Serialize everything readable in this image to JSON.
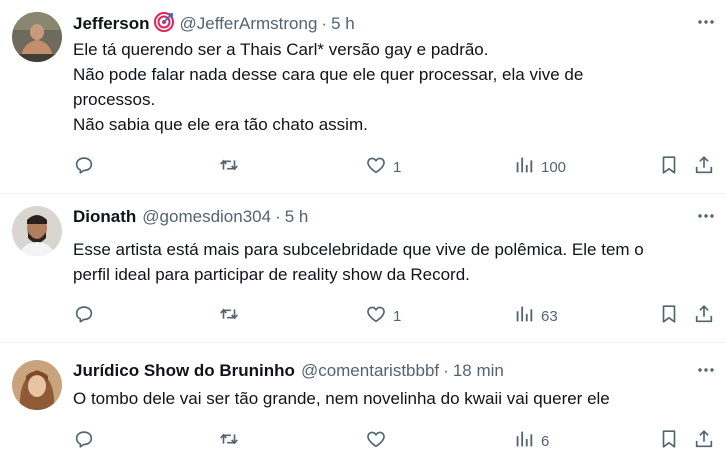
{
  "tweets": [
    {
      "name": "Jefferson",
      "handle": "@JefferArmstrong",
      "time": "5 h",
      "badge_icon": "target-icon",
      "lines": [
        "Ele tá querendo ser a Thais Carl* versão gay e padrão.",
        "Não pode falar nada desse cara que ele quer processar, ela vive de",
        "processos.",
        "Não sabia que ele era tão chato assim."
      ],
      "likes": "1",
      "views": "100"
    },
    {
      "name": "Dionath",
      "handle": "@gomesdion304",
      "time": "5 h",
      "lines": [
        "Esse artista está mais para subcelebridade que vive de polêmica. Ele tem o",
        "perfil ideal para participar de reality show da Record."
      ],
      "likes": "1",
      "views": "63"
    },
    {
      "name": "Jurídico Show do Bruninho",
      "handle": "@comentaristbbbf",
      "time": "18 min",
      "lines": [
        "O tombo dele vai ser tão grande, nem novelinha do kwaii vai querer ele"
      ],
      "likes": "",
      "views": "6"
    }
  ],
  "separator": "·",
  "colors": {
    "text": "#0f1419",
    "secondary": "#536471",
    "border": "#eff3f4"
  },
  "icons": [
    "reply-icon",
    "retweet-icon",
    "like-icon",
    "views-icon",
    "bookmark-icon",
    "share-icon",
    "more-icon"
  ]
}
